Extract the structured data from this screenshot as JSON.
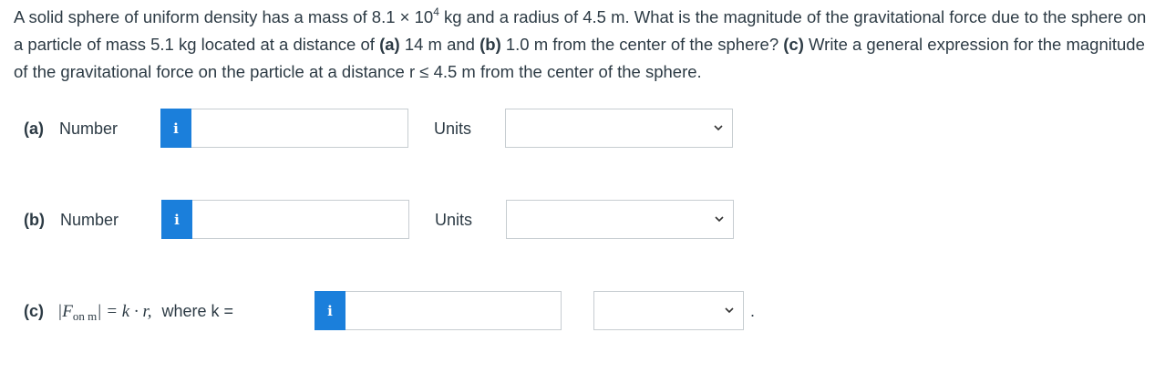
{
  "question": {
    "intro": "A solid sphere of uniform density has a mass of 8.1 × 10",
    "exp": "4",
    "mid1": " kg and a radius of 4.5 m. What is the magnitude of the gravitational force due to the sphere on a particle of mass 5.1 kg located at a distance of ",
    "a_tag": "(a)",
    "mid2": " 14 m and ",
    "b_tag": "(b)",
    "mid3": " 1.0 m from the center of the sphere? ",
    "c_tag": "(c)",
    "mid4": " Write a general expression for the magnitude of the gravitational force on the particle at a distance r ≤ 4.5 m from the center of the sphere."
  },
  "part_a": {
    "tag": "(a)",
    "label": "Number",
    "info": "i",
    "value": "",
    "units_label": "Units",
    "units_value": ""
  },
  "part_b": {
    "tag": "(b)",
    "label": "Number",
    "info": "i",
    "value": "",
    "units_label": "Units",
    "units_value": ""
  },
  "part_c": {
    "tag": "(c)",
    "expr_open": "|F",
    "expr_sub": "on m",
    "expr_close": "| = k · r,",
    "where": "where k =",
    "info": "i",
    "value": "",
    "units_value": "",
    "period": "."
  },
  "colors": {
    "info_button": "#1b7fdb",
    "text": "#2d3b45",
    "border": "#c7cdd1"
  },
  "icons": {
    "info": "info-icon",
    "dropdown": "chevron-down-icon"
  }
}
